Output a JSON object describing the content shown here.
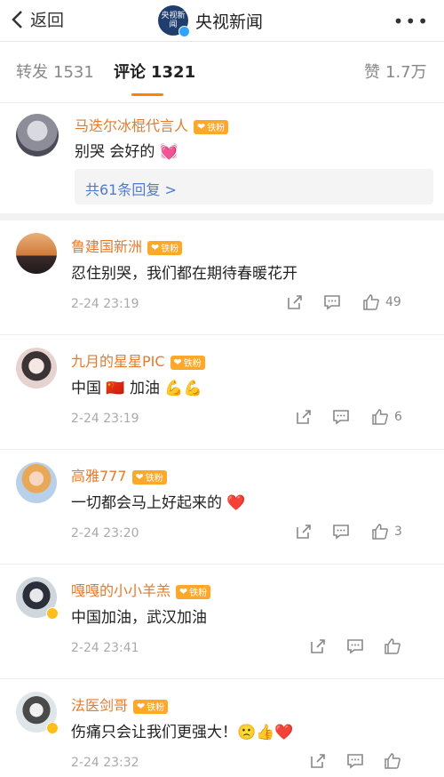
{
  "topbar": {
    "back_label": "返回",
    "logo_text": "央视新闻",
    "title": "央视新闻",
    "more": "•••"
  },
  "tabs": {
    "repost": {
      "label": "转发",
      "count": "1531"
    },
    "comments": {
      "label": "评论",
      "count": "1321"
    },
    "likes": {
      "label": "赞",
      "count": "1.7万"
    }
  },
  "main_comment": {
    "user": "马迭尔冰棍代言人",
    "badge": "铁粉",
    "text": "别哭 会好的",
    "emoji": "💓",
    "replies": "共61条回复 >"
  },
  "replies": [
    {
      "user": "鲁建国新洲",
      "badge": "铁粉",
      "text": "忍住别哭，我们都在期待春暖花开",
      "time": "2-24 23:19",
      "likes": "49"
    },
    {
      "user": "九月的星星PIC",
      "badge": "铁粉",
      "text": "中国 🇨🇳 加油 💪💪",
      "time": "2-24 23:19",
      "likes": "6"
    },
    {
      "user": "高雅777",
      "badge": "铁粉",
      "text": "一切都会马上好起来的 ❤️",
      "time": "2-24 23:20",
      "likes": "3"
    },
    {
      "user": "嘎嘎的小小羊羔",
      "badge": "铁粉",
      "text": "中国加油，武汉加油",
      "time": "2-24 23:41",
      "likes": ""
    },
    {
      "user": "法医剑哥",
      "badge": "铁粉",
      "text": "伤痛只会让我们更强大！🙁👍❤️",
      "time": "2-24 23:32",
      "likes": ""
    }
  ],
  "colors": {
    "accent": "#ff8200",
    "username": "#e37b2e",
    "link": "#4d7bd0"
  }
}
